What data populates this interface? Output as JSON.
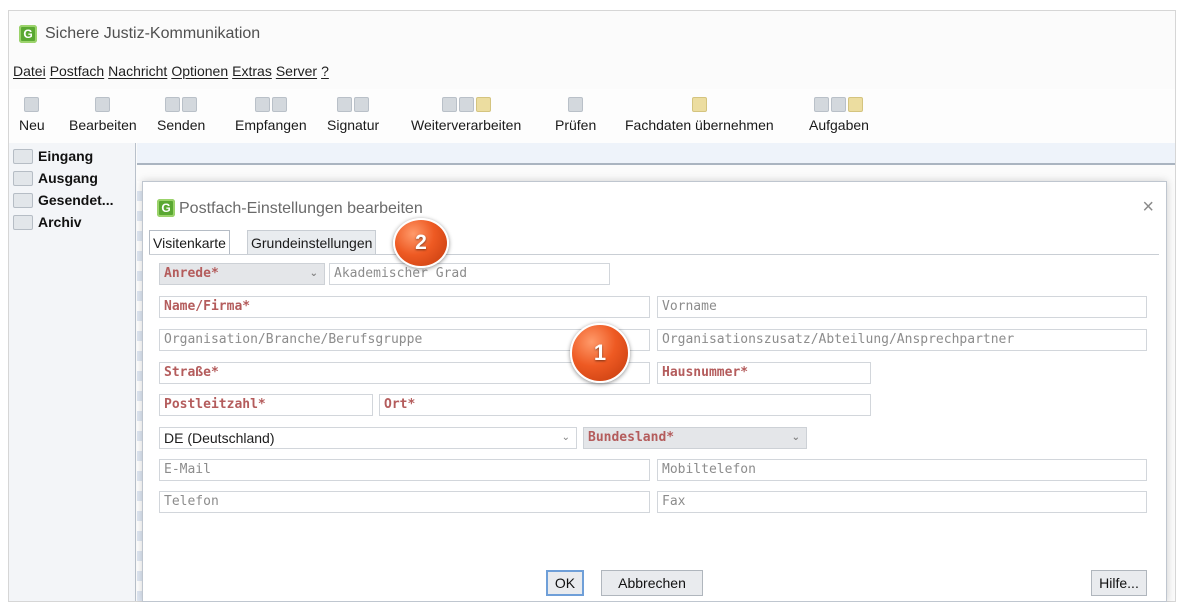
{
  "window": {
    "title": "Sichere Justiz-Kommunikation",
    "app_icon": "G"
  },
  "menu": [
    {
      "label": "Datei"
    },
    {
      "label": "Postfach"
    },
    {
      "label": "Nachricht"
    },
    {
      "label": "Optionen"
    },
    {
      "label": "Extras"
    },
    {
      "label": "Server"
    },
    {
      "label": "?"
    }
  ],
  "toolbar": [
    {
      "label": "Neu"
    },
    {
      "label": "Bearbeiten"
    },
    {
      "label": "Senden"
    },
    {
      "label": "Empfangen"
    },
    {
      "label": "Signatur"
    },
    {
      "label": "Weiterverarbeiten"
    },
    {
      "label": "Prüfen"
    },
    {
      "label": "Fachdaten übernehmen"
    },
    {
      "label": "Aufgaben"
    }
  ],
  "sidebar": [
    {
      "label": "Eingang"
    },
    {
      "label": "Ausgang"
    },
    {
      "label": "Gesendet..."
    },
    {
      "label": "Archiv"
    }
  ],
  "dialog": {
    "app_icon": "G",
    "title": "Postfach-Einstellungen bearbeiten",
    "close": "×",
    "tabs": [
      {
        "label": "Visitenkarte",
        "active": true
      },
      {
        "label": "Grundeinstellungen",
        "active": false
      }
    ],
    "fields": {
      "anrede": "Anrede*",
      "akad_grad": "Akademischer Grad",
      "name": "Name/Firma*",
      "vorname": "Vorname",
      "organisation": "Organisation/Branche/Berufsgruppe",
      "org_zusatz": "Organisationszusatz/Abteilung/Ansprechpartner",
      "strasse": "Straße*",
      "hausnummer": "Hausnummer*",
      "plz": "Postleitzahl*",
      "ort": "Ort*",
      "land": "DE (Deutschland)",
      "bundesland": "Bundesland*",
      "email": "E-Mail",
      "mobil": "Mobiltelefon",
      "telefon": "Telefon",
      "fax": "Fax"
    },
    "buttons": {
      "ok": "OK",
      "cancel": "Abbrechen",
      "help": "Hilfe..."
    }
  },
  "callouts": [
    {
      "label": "1"
    },
    {
      "label": "2"
    }
  ],
  "colors": {
    "required_text": "#b45c5c",
    "callout": "#ee5a23",
    "app_green": "#5aa832"
  }
}
